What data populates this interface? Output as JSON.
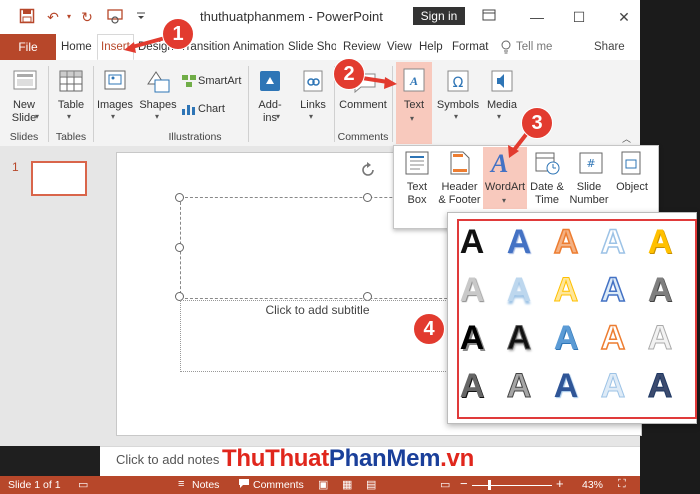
{
  "window": {
    "title": "thuthuatphanmem - PowerPoint",
    "signin": "Sign in"
  },
  "tabs": [
    "File",
    "Home",
    "Insert",
    "Design",
    "Transition",
    "Animation",
    "Slide Show",
    "Review",
    "View",
    "Help",
    "Format"
  ],
  "tell_me": "Tell me",
  "share": "Share",
  "ribbon": {
    "new_slide": "New Slide",
    "table": "Table",
    "images": "Images",
    "shapes": "Shapes",
    "smartart": "SmartArt",
    "chart": "Chart",
    "addins": "Add-ins",
    "links": "Links",
    "comment": "Comment",
    "text": "Text",
    "symbols": "Symbols",
    "media": "Media",
    "groups": {
      "slides": "Slides",
      "tables": "Tables",
      "illustrations": "Illustrations",
      "comments": "Comments"
    }
  },
  "text_menu": {
    "textbox": "Text Box",
    "header_footer": "Header & Footer",
    "wordart": "WordArt",
    "date_time": "Date & Time",
    "slide_number": "Slide Number",
    "object": "Object"
  },
  "slide": {
    "number": "1",
    "subtitle_placeholder": "Click to add subtitle",
    "notes_placeholder": "Click to add notes"
  },
  "status": {
    "slide_count": "Slide 1 of 1",
    "notes": "Notes",
    "comments": "Comments",
    "zoom": "43%"
  },
  "callouts": [
    "1",
    "2",
    "3",
    "4"
  ],
  "watermark": {
    "part1": "ThuThuat",
    "part2": "PhanMem",
    "part3": ".vn"
  },
  "wordart_letter": "A",
  "colors": {
    "accent": "#b7472a",
    "callout": "#e23b2f",
    "wordart_blue": "#4472c4",
    "wordart_orange": "#ed7d31",
    "wordart_gold": "#ffc000"
  }
}
